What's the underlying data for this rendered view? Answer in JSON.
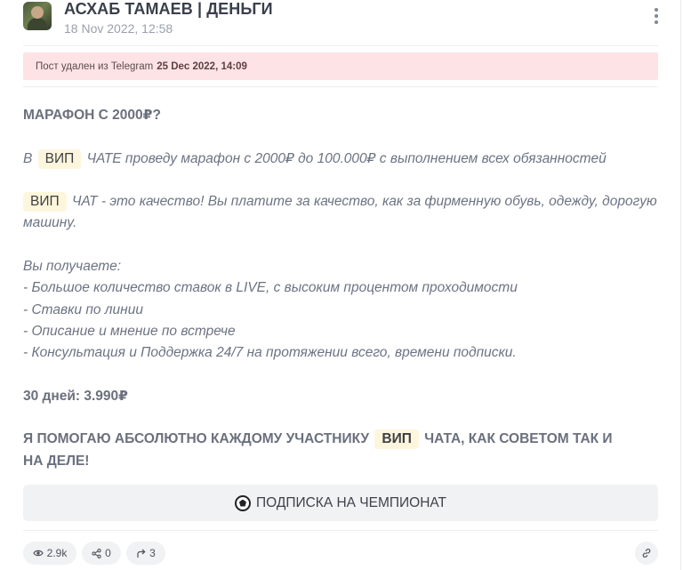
{
  "post": {
    "channel_name": "АСХАБ ТАМАЕВ | ДЕНЬГИ",
    "date": "18 Nov 2022, 12:58",
    "deleted_notice": {
      "text": "Пост удален из Telegram",
      "date": "25 Dec 2022, 14:09"
    },
    "body": {
      "heading": "МАРАФОН С 2000₽?",
      "p1_prefix": "В",
      "p1_tag": "ВИП",
      "p1_rest": "ЧАТЕ проведу марафон с 2000₽ до 100.000₽ с выполнением всех обязанностей",
      "p2_tag": "ВИП",
      "p2_rest": "ЧАТ - это качество! Вы платите за качество, как за фирменную обувь, одежду, дорогую",
      "p2_line2": "машину.",
      "list_intro": "Вы получаете:",
      "list_items": [
        "- Большое количество ставок в LIVE, с высоким процентом проходимости",
        "- Ставки по линии",
        "- Описание и мнение по встрече",
        "- Консультация и Поддержка 24/7 на протяжении всего, времени подписки."
      ],
      "price": "30 дней: 3.990₽",
      "closing_prefix": "Я ПОМОГАЮ АБСОЛЮТНО КАЖДОМУ УЧАСТНИКУ",
      "closing_tag": "ВИП",
      "closing_rest": "ЧАТА, КАК СОВЕТОМ ТАК И",
      "closing_line2": "НА ДЕЛЕ!"
    },
    "button": {
      "icon": "soccer-ball-icon",
      "label": "ПОДПИСКА НА ЧЕМПИОНАТ"
    },
    "stats": {
      "views": "2.9k",
      "shares": "0",
      "forwards": "3"
    }
  },
  "colors": {
    "deleted_banner_bg": "#fde3e5",
    "tag_bg": "#fdf6dc",
    "button_bg": "#f1f2f4"
  }
}
